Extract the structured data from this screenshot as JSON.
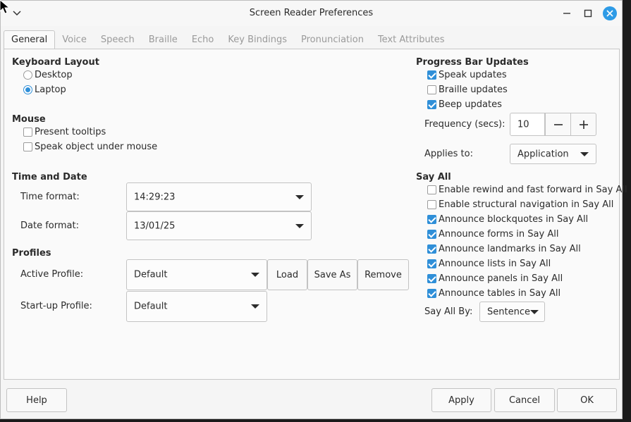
{
  "window": {
    "title": "Screen Reader Preferences"
  },
  "tabs": [
    "General",
    "Voice",
    "Speech",
    "Braille",
    "Echo",
    "Key Bindings",
    "Pronunciation",
    "Text Attributes"
  ],
  "keyboard_layout": {
    "heading": "Keyboard Layout",
    "options": [
      {
        "label": "Desktop",
        "selected": false
      },
      {
        "label": "Laptop",
        "selected": true
      }
    ]
  },
  "mouse": {
    "heading": "Mouse",
    "options": [
      {
        "label": "Present tooltips",
        "checked": false
      },
      {
        "label": "Speak object under mouse",
        "checked": false
      }
    ]
  },
  "time_date": {
    "heading": "Time and Date",
    "time_label": "Time format:",
    "time_value": "14:29:23",
    "date_label": "Date format:",
    "date_value": "13/01/25"
  },
  "profiles": {
    "heading": "Profiles",
    "active_label": "Active Profile:",
    "active_value": "Default",
    "load": "Load",
    "save_as": "Save As",
    "remove": "Remove",
    "startup_label": "Start-up Profile:",
    "startup_value": "Default"
  },
  "progress": {
    "heading": "Progress Bar Updates",
    "options": [
      {
        "label": "Speak updates",
        "checked": true
      },
      {
        "label": "Braille updates",
        "checked": false
      },
      {
        "label": "Beep updates",
        "checked": true
      }
    ],
    "frequency_label": "Frequency (secs):",
    "frequency_value": "10",
    "applies_label": "Applies to:",
    "applies_value": "Application"
  },
  "say_all": {
    "heading": "Say All",
    "options": [
      {
        "label": "Enable rewind and fast forward in Say All",
        "checked": false
      },
      {
        "label": "Enable structural navigation in Say All",
        "checked": false
      },
      {
        "label": "Announce blockquotes in Say All",
        "checked": true
      },
      {
        "label": "Announce forms in Say All",
        "checked": true
      },
      {
        "label": "Announce landmarks in Say All",
        "checked": true
      },
      {
        "label": "Announce lists in Say All",
        "checked": true
      },
      {
        "label": "Announce panels in Say All",
        "checked": true
      },
      {
        "label": "Announce tables in Say All",
        "checked": true
      }
    ],
    "by_label": "Say All By:",
    "by_value": "Sentence"
  },
  "footer": {
    "help": "Help",
    "apply": "Apply",
    "cancel": "Cancel",
    "ok": "OK"
  },
  "colors": {
    "accent": "#2f8fd8",
    "close": "#2e9be6"
  }
}
